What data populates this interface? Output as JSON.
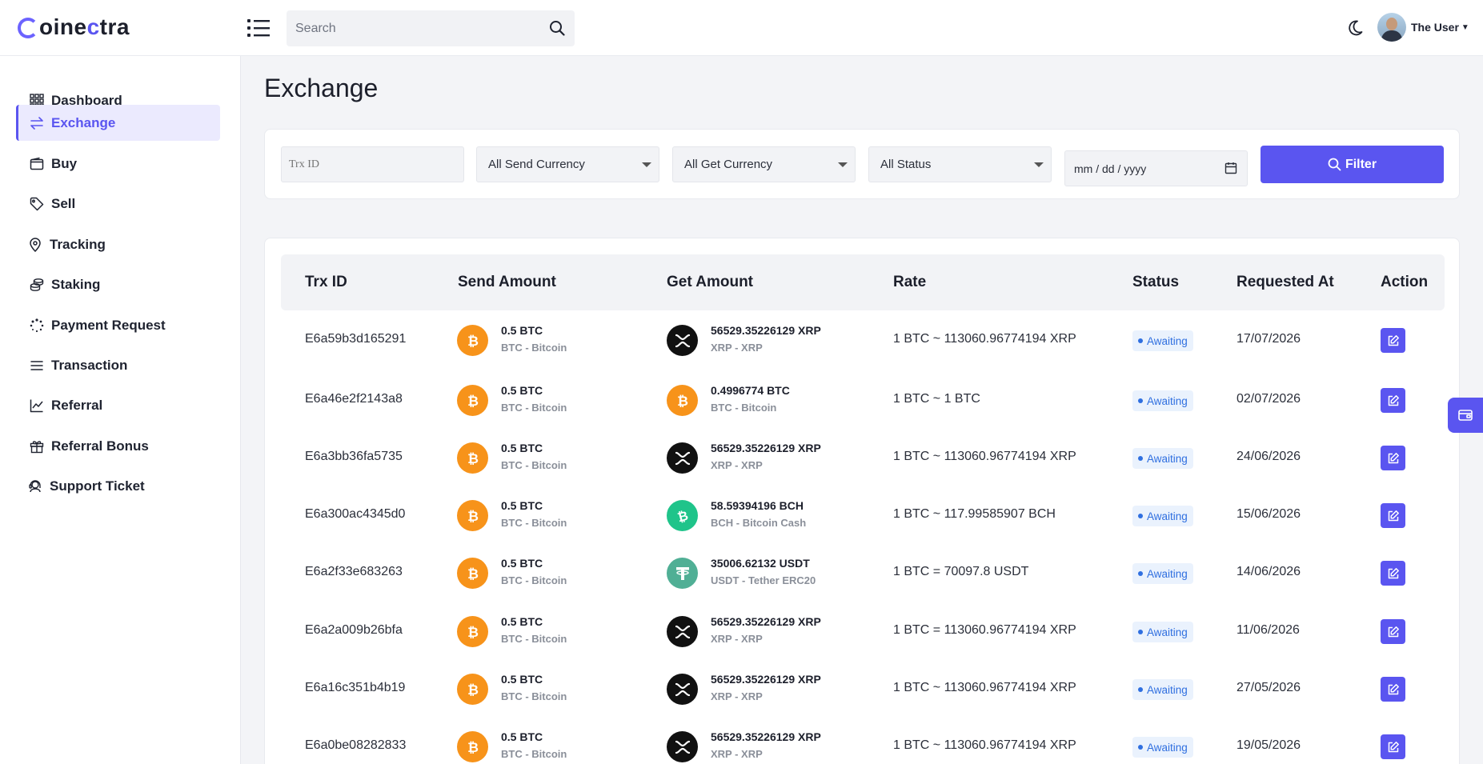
{
  "app": {
    "logo_prefix": "oine",
    "logo_highlight": "c",
    "logo_suffix": "tra"
  },
  "header": {
    "search_placeholder": "Search",
    "user_name": "The User"
  },
  "sidebar": {
    "items": [
      {
        "label": "Dashboard",
        "icon": "grid-icon"
      },
      {
        "label": "Exchange",
        "icon": "exchange-arrows-icon",
        "active": true
      },
      {
        "label": "Buy",
        "icon": "wallet-icon"
      },
      {
        "label": "Sell",
        "icon": "tag-icon"
      },
      {
        "label": "Tracking",
        "icon": "location-pin-icon"
      },
      {
        "label": "Staking",
        "icon": "coins-stack-icon"
      },
      {
        "label": "Payment Request",
        "icon": "dotted-circle-icon"
      },
      {
        "label": "Transaction",
        "icon": "list-lines-icon"
      },
      {
        "label": "Referral",
        "icon": "line-chart-icon"
      },
      {
        "label": "Referral Bonus",
        "icon": "gift-icon"
      },
      {
        "label": "Support Ticket",
        "icon": "headset-icon"
      }
    ]
  },
  "page": {
    "title": "Exchange"
  },
  "filters": {
    "trx_placeholder": "Trx ID",
    "send_currency": "All Send Currency",
    "get_currency": "All Get Currency",
    "status": "All Status",
    "date_placeholder": "mm / dd / yyyy",
    "filter_label": "Filter"
  },
  "table": {
    "headers": [
      "Trx ID",
      "Send Amount",
      "Get Amount",
      "Rate",
      "Status",
      "Requested At",
      "Action"
    ],
    "rows": [
      {
        "trx": "E6a59b3d165291",
        "send_amt": "0.5 BTC",
        "send_cur": "BTC - Bitcoin",
        "send_coin": "btc",
        "get_amt": "56529.35226129 XRP",
        "get_cur": "XRP - XRP",
        "get_coin": "xrp",
        "rate": "1 BTC ~ 113060.96774194 XRP",
        "status": "Awaiting",
        "date": "17/07/2026"
      },
      {
        "trx": "E6a46e2f2143a8",
        "send_amt": "0.5 BTC",
        "send_cur": "BTC - Bitcoin",
        "send_coin": "btc",
        "get_amt": "0.4996774 BTC",
        "get_cur": "BTC - Bitcoin",
        "get_coin": "btc",
        "rate": "1 BTC ~ 1 BTC",
        "status": "Awaiting",
        "date": "02/07/2026"
      },
      {
        "trx": "E6a3bb36fa5735",
        "send_amt": "0.5 BTC",
        "send_cur": "BTC - Bitcoin",
        "send_coin": "btc",
        "get_amt": "56529.35226129 XRP",
        "get_cur": "XRP - XRP",
        "get_coin": "xrp",
        "rate": "1 BTC ~ 113060.96774194 XRP",
        "status": "Awaiting",
        "date": "24/06/2026"
      },
      {
        "trx": "E6a300ac4345d0",
        "send_amt": "0.5 BTC",
        "send_cur": "BTC - Bitcoin",
        "send_coin": "btc",
        "get_amt": "58.59394196 BCH",
        "get_cur": "BCH - Bitcoin Cash",
        "get_coin": "bch",
        "rate": "1 BTC ~ 117.99585907 BCH",
        "status": "Awaiting",
        "date": "15/06/2026"
      },
      {
        "trx": "E6a2f33e683263",
        "send_amt": "0.5 BTC",
        "send_cur": "BTC - Bitcoin",
        "send_coin": "btc",
        "get_amt": "35006.62132 USDT",
        "get_cur": "USDT - Tether ERC20",
        "get_coin": "usdt",
        "rate": "1 BTC = 70097.8 USDT",
        "status": "Awaiting",
        "date": "14/06/2026"
      },
      {
        "trx": "E6a2a009b26bfa",
        "send_amt": "0.5 BTC",
        "send_cur": "BTC - Bitcoin",
        "send_coin": "btc",
        "get_amt": "56529.35226129 XRP",
        "get_cur": "XRP - XRP",
        "get_coin": "xrp",
        "rate": "1 BTC = 113060.96774194 XRP",
        "status": "Awaiting",
        "date": "11/06/2026"
      },
      {
        "trx": "E6a16c351b4b19",
        "send_amt": "0.5 BTC",
        "send_cur": "BTC - Bitcoin",
        "send_coin": "btc",
        "get_amt": "56529.35226129 XRP",
        "get_cur": "XRP - XRP",
        "get_coin": "xrp",
        "rate": "1 BTC ~ 113060.96774194 XRP",
        "status": "Awaiting",
        "date": "27/05/2026"
      },
      {
        "trx": "E6a0be08282833",
        "send_amt": "0.5 BTC",
        "send_cur": "BTC - Bitcoin",
        "send_coin": "btc",
        "get_amt": "56529.35226129 XRP",
        "get_cur": "XRP - XRP",
        "get_coin": "xrp",
        "rate": "1 BTC ~ 113060.96774194 XRP",
        "status": "Awaiting",
        "date": "19/05/2026"
      }
    ]
  },
  "colors": {
    "accent": "#5a55f0",
    "badge_text": "#2f6fe0",
    "btc": "#f7931a",
    "bch": "#1fc48a",
    "usdt": "#50af95"
  }
}
